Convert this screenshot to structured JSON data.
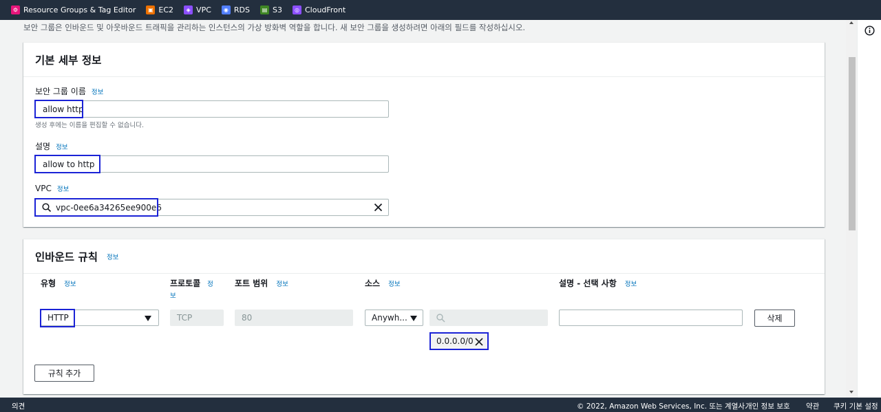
{
  "topbar": {
    "favorites": [
      {
        "label": "Resource Groups & Tag Editor",
        "icon": "resource-groups-icon",
        "color": "#e7157b"
      },
      {
        "label": "EC2",
        "icon": "ec2-icon",
        "color": "#ed7100"
      },
      {
        "label": "VPC",
        "icon": "vpc-icon",
        "color": "#8c4fff"
      },
      {
        "label": "RDS",
        "icon": "rds-icon",
        "color": "#527fff"
      },
      {
        "label": "S3",
        "icon": "s3-icon",
        "color": "#3f8624"
      },
      {
        "label": "CloudFront",
        "icon": "cloudfront-icon",
        "color": "#8c4fff"
      }
    ]
  },
  "intro": "보안 그룹은 인바운드 및 아웃바운드 트래픽을 관리하는 인스턴스의 가상 방화벽 역할을 합니다. 새 보안 그룹을 생성하려면 아래의 필드를 작성하십시오.",
  "basic": {
    "title": "기본 세부 정보",
    "name_label": "보안 그룹 이름",
    "name_info": "정보",
    "name_value": "allow http",
    "name_hint": "생성 후에는 이름을 편집할 수 없습니다.",
    "desc_label": "설명",
    "desc_info": "정보",
    "desc_value": "allow to http",
    "vpc_label": "VPC",
    "vpc_info": "정보",
    "vpc_value": "vpc-0ee6a34265ee900e6"
  },
  "inbound": {
    "title": "인바운드 규칙",
    "title_info": "정보",
    "headers": {
      "type": "유형",
      "type_info": "정보",
      "protocol": "프로토콜",
      "protocol_info_a": "정",
      "protocol_info_b": "보",
      "port": "포트 범위",
      "port_info": "정보",
      "source": "소스",
      "source_info": "정보",
      "desc": "설명 - 선택 사항",
      "desc_info": "정보"
    },
    "row": {
      "type": "HTTP",
      "protocol": "TCP",
      "port": "80",
      "source": "Anywh...",
      "cidr": "0.0.0.0/0",
      "delete": "삭제"
    },
    "add_rule": "규칙 추가"
  },
  "footer": {
    "feedback": "의견",
    "copyright": "© 2022, Amazon Web Services, Inc. 또는 계열사.",
    "privacy": "개인 정보 보호",
    "terms": "약관",
    "cookies": "쿠키 기본 설정"
  }
}
